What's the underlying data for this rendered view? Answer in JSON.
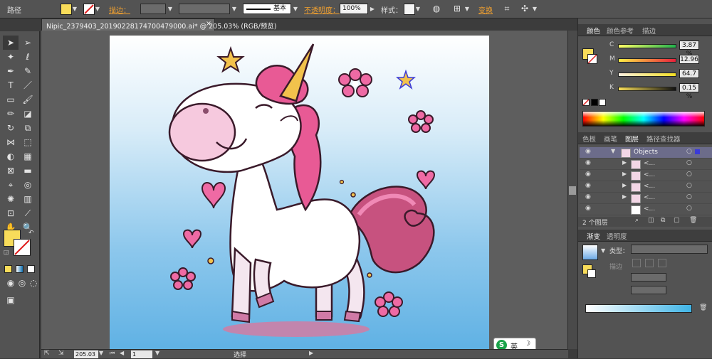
{
  "controlbar": {
    "mode_label": "路径",
    "stroke_label": "描边：",
    "stroke_style_label": "基本",
    "opacity_label": "不透明度：",
    "opacity_value": "100%",
    "style_label": "样式：",
    "transform_label": "变换",
    "fill_color": "#f8dc5a"
  },
  "document": {
    "tab_title": "Nipic_2379403_20190228174700479000.ai* @ 205.03% (RGB/预览)"
  },
  "status": {
    "zoom": "205.03",
    "page": "1",
    "tool": "选择"
  },
  "color_panel": {
    "tabs": [
      "颜色",
      "颜色参考",
      "描边"
    ],
    "channels": [
      {
        "label": "C",
        "value": "3.87 %"
      },
      {
        "label": "M",
        "value": "12.96"
      },
      {
        "label": "Y",
        "value": "64.7"
      },
      {
        "label": "K",
        "value": "0.15 %"
      }
    ]
  },
  "layers_panel": {
    "tabs": [
      "色板",
      "画笔",
      "图层",
      "路径查找器"
    ],
    "rows": [
      {
        "name": "Objects"
      },
      {
        "name": "<..."
      },
      {
        "name": "<..."
      },
      {
        "name": "<..."
      },
      {
        "name": "<..."
      },
      {
        "name": "<..."
      }
    ],
    "count": "2 个图层"
  },
  "gradient_panel": {
    "tabs": [
      "渐变",
      "透明度"
    ],
    "type_label": "类型：",
    "stroke_label": "描边"
  },
  "ime": {
    "logo": "S",
    "lang": "英"
  }
}
